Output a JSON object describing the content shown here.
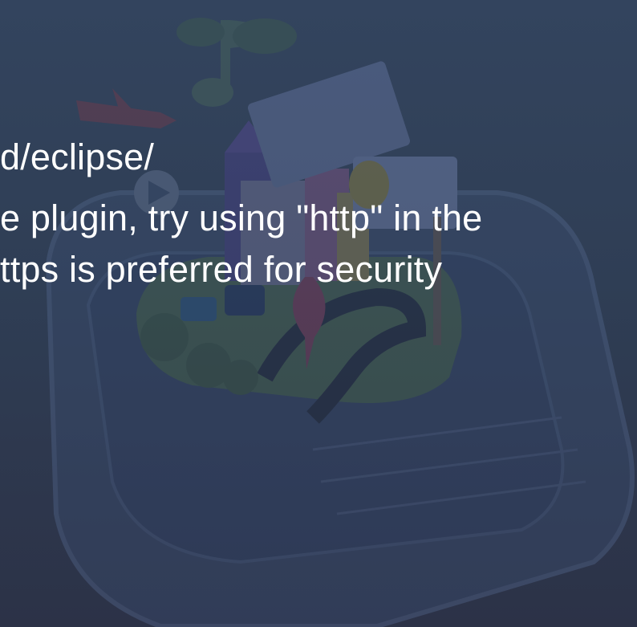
{
  "slide": {
    "lines": [
      "d/eclipse/",
      "e plugin, try using \"http\" in the",
      "ttps is preferred for security"
    ]
  },
  "colors": {
    "background_top": "#33445e",
    "background_bottom": "#2c3247",
    "text": "#ffffff"
  },
  "illustration": {
    "icon": "android-phone-city-illustration"
  }
}
